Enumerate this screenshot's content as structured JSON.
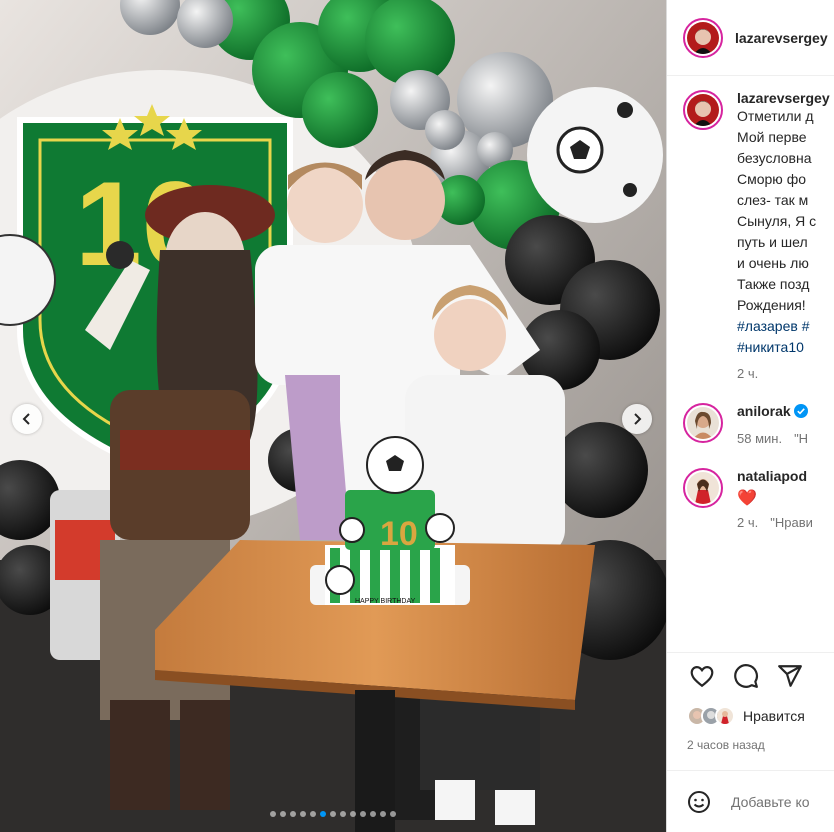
{
  "post": {
    "username": "lazarevsergey",
    "caption_lines": [
      "Отметили д",
      "Мой перве",
      "безусловна",
      "Сморю фо",
      "слез- так м",
      "Сынуля, Я с",
      "путь и шел",
      "и очень лю",
      "Также позд",
      "Рождения!"
    ],
    "hashtag_lines": [
      "#лазарев #",
      "#никита10"
    ],
    "time": "2 ч.",
    "cake_text": "HAPPY BIRTHDAY",
    "cake_number": "10",
    "banner_number": "10"
  },
  "comments": [
    {
      "username": "anilorak",
      "verified": true,
      "text": "",
      "time": "58 мин.",
      "reply": "\"Н"
    },
    {
      "username": "nataliapod",
      "verified": false,
      "text": "❤️",
      "time": "2 ч.",
      "reply": "\"Нрави"
    }
  ],
  "actions": {
    "like_icon": "heart-outline-icon",
    "comment_icon": "comment-bubble-icon",
    "share_icon": "paper-plane-icon"
  },
  "likes": {
    "label": "Нравится"
  },
  "timestamp": "2 часов назад",
  "add_comment": {
    "placeholder": "Добавьте ко"
  },
  "carousel": {
    "count": 13,
    "active": 5
  },
  "colors": {
    "accent": "#0095f6",
    "link": "#00376b",
    "heart": "#ed4956",
    "verified": "#0095f6"
  }
}
